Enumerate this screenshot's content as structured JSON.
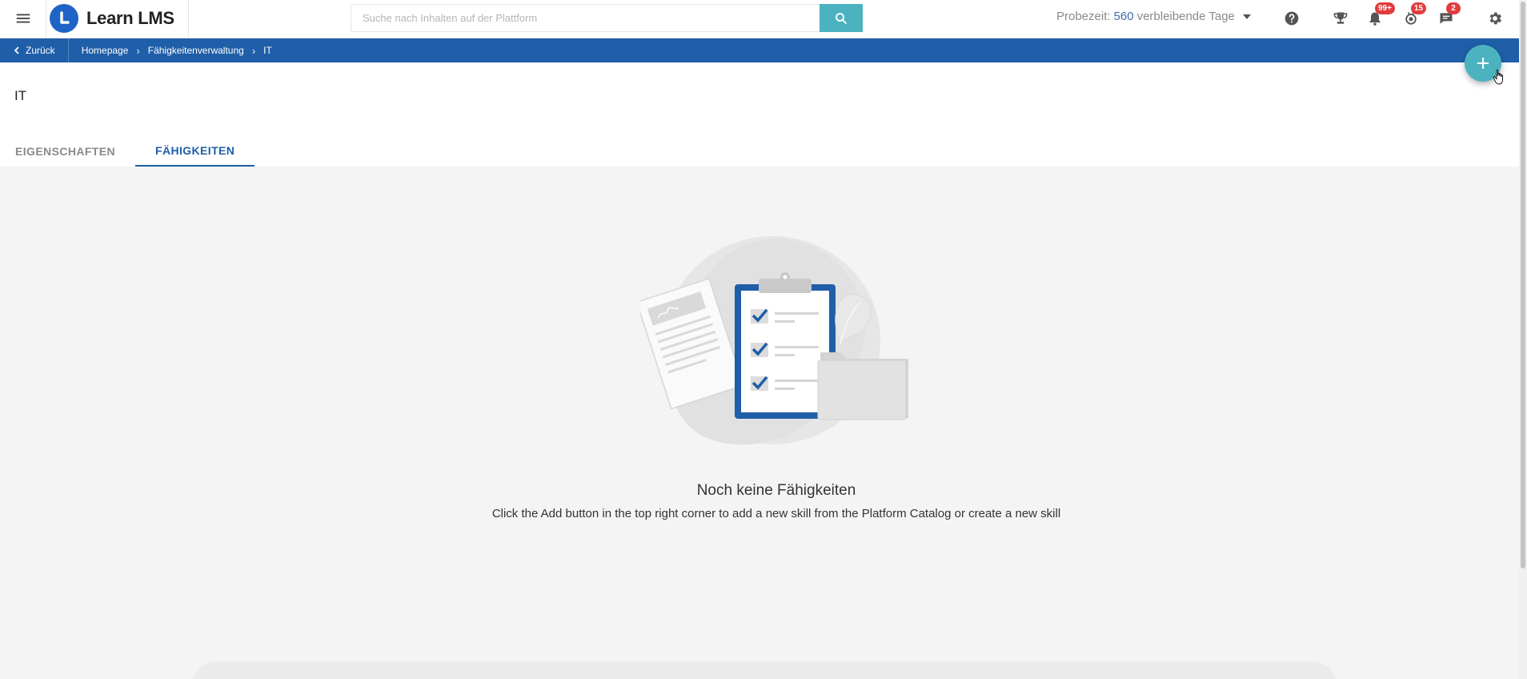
{
  "app": {
    "name": "Learn LMS"
  },
  "search": {
    "placeholder": "Suche nach Inhalten auf der Plattform"
  },
  "trial": {
    "prefix": "Probezeit:",
    "days": "560",
    "suffix": "verbleibende Tage"
  },
  "header_icons": {
    "help": "help-icon",
    "trophy": "trophy-icon",
    "notifications": {
      "icon": "bell-icon",
      "badge": "99+"
    },
    "badges": {
      "icon": "medal-icon",
      "badge": "15"
    },
    "messages": {
      "icon": "chat-icon",
      "badge": "2"
    },
    "settings": "gear-icon"
  },
  "breadcrumb": {
    "back_label": "Zurück",
    "items": [
      "Homepage",
      "Fähigkeitenverwaltung",
      "IT"
    ]
  },
  "page": {
    "title": "IT",
    "tabs": [
      {
        "label": "EIGENSCHAFTEN",
        "active": false
      },
      {
        "label": "FÄHIGKEITEN",
        "active": true
      }
    ]
  },
  "empty_state": {
    "title": "Noch keine Fähigkeiten",
    "text": "Click the Add button in the top right corner to add a new skill from the Platform Catalog or create a new skill"
  },
  "colors": {
    "brand_blue": "#1f5ea8",
    "accent_teal": "#4bb2c0",
    "badge_red": "#e23b3b"
  }
}
